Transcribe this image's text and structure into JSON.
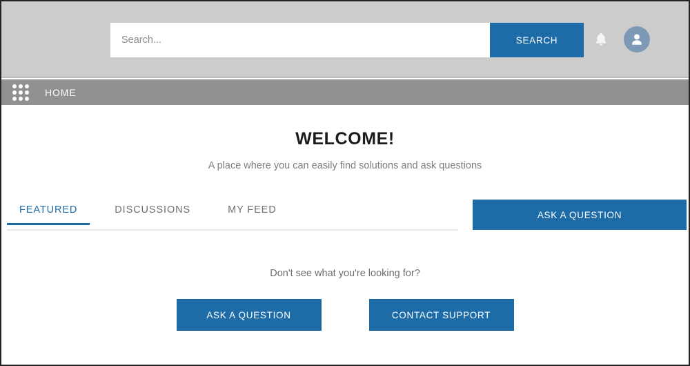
{
  "theme": {
    "accent_blue": "#1d6ca8",
    "header_gray": "#cccccc",
    "navbar_gray": "#919191",
    "avatar_blue": "#7d99b6",
    "text_muted": "#7d7d7d"
  },
  "header": {
    "search": {
      "placeholder": "Search...",
      "value": "",
      "button_label": "SEARCH",
      "search_button_name": "search-button"
    },
    "notifications_icon": "bell-icon",
    "avatar_icon": "user-avatar-icon"
  },
  "navbar": {
    "app_launcher_icon": "app-grid-icon",
    "home_label": "HOME"
  },
  "main": {
    "title": "WELCOME!",
    "subtitle": "A place where you can easily find solutions and ask questions",
    "tabs": [
      {
        "label": "FEATURED",
        "active": true
      },
      {
        "label": "DISCUSSIONS",
        "active": false
      },
      {
        "label": "MY FEED",
        "active": false
      }
    ],
    "ask_question_top_label": "ASK A QUESTION",
    "empty_state": {
      "message": "Don't see what you're looking for?",
      "primary_button_label": "ASK A QUESTION",
      "secondary_button_label": "CONTACT SUPPORT"
    }
  }
}
